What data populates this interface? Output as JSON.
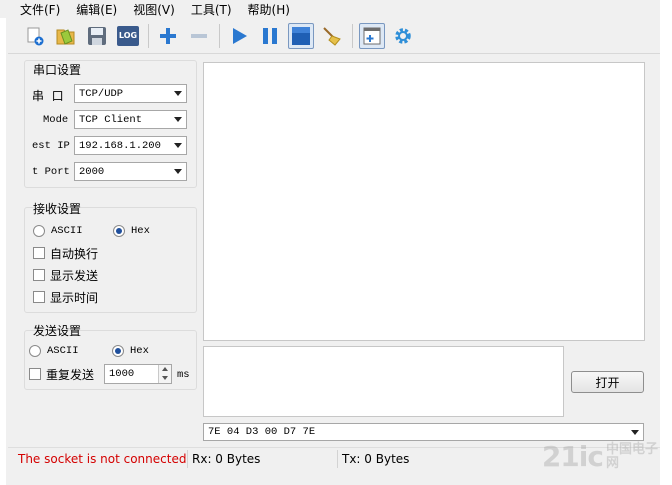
{
  "menu": [
    "文件(F)",
    "编辑(E)",
    "视图(V)",
    "工具(T)",
    "帮助(H)"
  ],
  "toolbar": {
    "log_label": "LOG",
    "icons": [
      "new-file-icon",
      "open-folder-icon",
      "save-icon",
      "log-icon",
      "add-icon",
      "remove-icon",
      "play-icon",
      "pause-icon",
      "stop-icon",
      "clear-broom-icon",
      "add-window-icon",
      "gear-icon"
    ]
  },
  "serial_settings": {
    "title": "串口设置",
    "port_label": "串  口",
    "port_value": "TCP/UDP",
    "mode_label": "Mode",
    "mode_value": "TCP Client",
    "ip_label": "est IP",
    "ip_value": "192.168.1.200",
    "tport_label": "t Port",
    "tport_value": "2000"
  },
  "receive_settings": {
    "title": "接收设置",
    "ascii_label": "ASCII",
    "hex_label": "Hex",
    "selected": "Hex",
    "auto_wrap_label": "自动换行",
    "show_send_label": "显示发送",
    "show_time_label": "显示时间"
  },
  "send_settings": {
    "title": "发送设置",
    "ascii_label": "ASCII",
    "hex_label": "Hex",
    "selected": "Hex",
    "repeat_label": "重复发送",
    "interval_value": "1000",
    "interval_unit": "ms"
  },
  "open_button": "打开",
  "send_data": "7E 04 D3 00 D7 7E",
  "status": {
    "connection": "The socket is not connected",
    "rx": "Rx: 0 Bytes",
    "tx": "Tx: 0 Bytes"
  },
  "colors": {
    "status_error": "#d40000",
    "accent_blue": "#2a78d0"
  },
  "watermark": {
    "text": "21ic",
    "cn": "中国电子网"
  }
}
